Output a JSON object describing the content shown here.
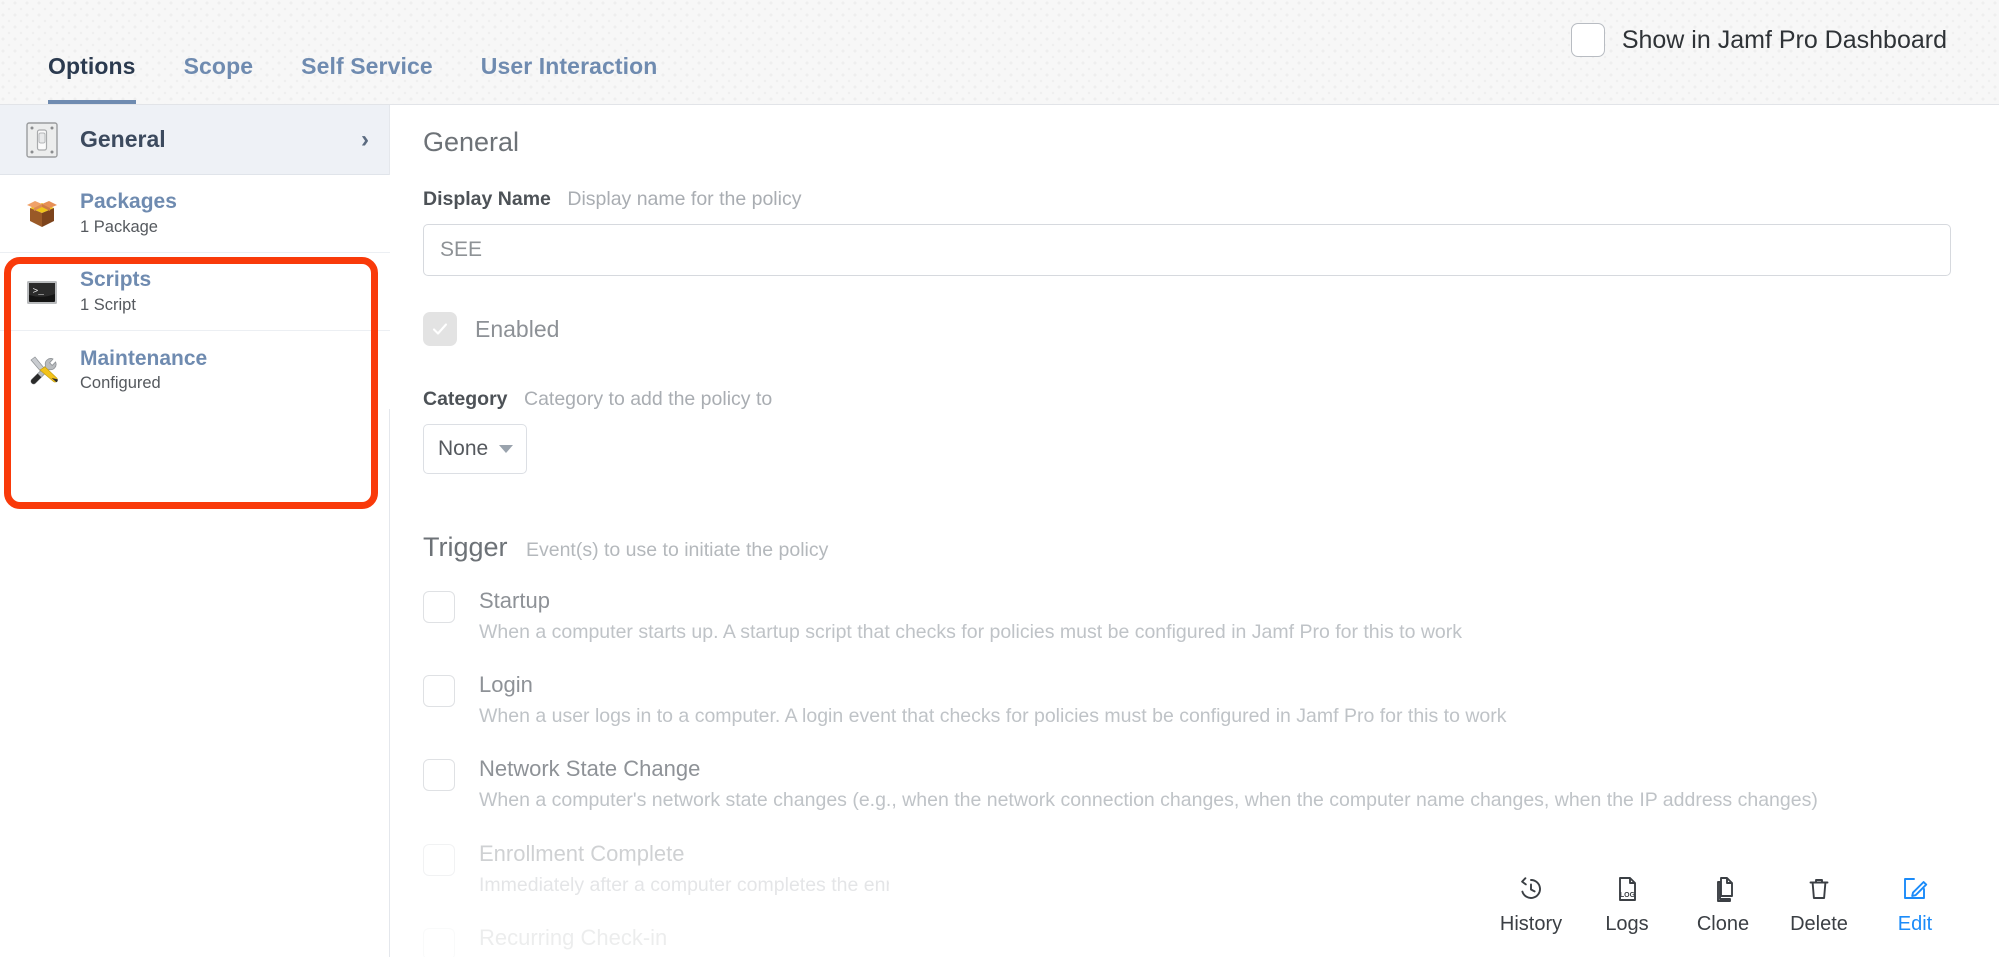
{
  "tabs": [
    {
      "label": "Options",
      "active": true
    },
    {
      "label": "Scope",
      "active": false
    },
    {
      "label": "Self Service",
      "active": false
    },
    {
      "label": "User Interaction",
      "active": false
    }
  ],
  "dashboard_toggle": {
    "label": "Show in Jamf Pro Dashboard",
    "checked": false
  },
  "sidebar": {
    "general": {
      "label": "General",
      "icon": "switch-plate-icon",
      "chevron": "›"
    },
    "items": [
      {
        "label": "Packages",
        "sub": "1 Package",
        "icon": "open-box-icon"
      },
      {
        "label": "Scripts",
        "sub": "1 Script",
        "icon": "terminal-icon"
      },
      {
        "label": "Maintenance",
        "sub": "Configured",
        "icon": "tools-icon"
      }
    ],
    "highlight_color": "#f93a0a"
  },
  "main": {
    "section_title": "General",
    "display_name": {
      "label": "Display Name",
      "hint": "Display name for the policy",
      "value": "",
      "placeholder": "SEE"
    },
    "enabled": {
      "label": "Enabled",
      "checked": true,
      "disabled": true
    },
    "category": {
      "label": "Category",
      "hint": "Category to add the policy to",
      "value": "None",
      "options": [
        "None"
      ]
    },
    "trigger": {
      "title": "Trigger",
      "hint": "Event(s) to use to initiate the policy",
      "items": [
        {
          "name": "Startup",
          "desc": "When a computer starts up. A startup script that checks for policies must be configured in Jamf Pro for this to work",
          "checked": false
        },
        {
          "name": "Login",
          "desc": "When a user logs in to a computer. A login event that checks for policies must be configured in Jamf Pro for this to work",
          "checked": false
        },
        {
          "name": "Network State Change",
          "desc": "When a computer's network state changes (e.g., when the network connection changes, when the computer name changes, when the IP address changes)",
          "checked": false
        },
        {
          "name": "Enrollment Complete",
          "desc": "Immediately after a computer completes the enrollment process",
          "checked": false
        },
        {
          "name": "Recurring Check-in",
          "desc": "",
          "checked": false
        }
      ]
    }
  },
  "actions": [
    {
      "label": "History",
      "icon": "history-clock-icon"
    },
    {
      "label": "Logs",
      "icon": "log-document-icon"
    },
    {
      "label": "Clone",
      "icon": "copy-pages-icon"
    },
    {
      "label": "Delete",
      "icon": "trash-icon"
    },
    {
      "label": "Edit",
      "icon": "pencil-square-icon",
      "accent": "#1b8bf9"
    }
  ]
}
